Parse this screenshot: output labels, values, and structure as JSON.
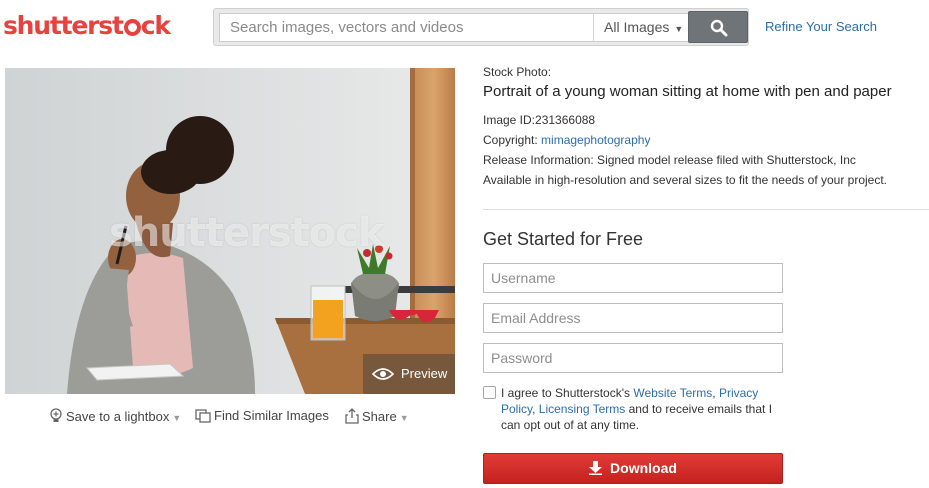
{
  "header": {
    "logo_pre": "shutterst",
    "logo_post": "ck",
    "search_placeholder": "Search images, vectors and videos",
    "filter_label": "All Images",
    "refine_link": "Refine Your Search"
  },
  "image": {
    "watermark": "shutterstock",
    "preview_label": "Preview"
  },
  "image_actions": {
    "lightbox": "Save to a lightbox",
    "similar": "Find Similar Images",
    "share": "Share"
  },
  "info": {
    "kicker": "Stock Photo:",
    "title": "Portrait of a young woman sitting at home with pen and paper",
    "image_id_label": "Image ID:",
    "image_id": "231366088",
    "copyright_label": "Copyright:",
    "copyright_value": "mimagephotography",
    "release": "Release Information: Signed model release filed with Shutterstock, Inc",
    "availability": "Available in high-resolution and several sizes to fit the needs of your project."
  },
  "signup": {
    "title": "Get Started for Free",
    "username_placeholder": "Username",
    "email_placeholder": "Email Address",
    "password_placeholder": "Password",
    "agree_pre": "I agree to Shutterstock's ",
    "website_terms": "Website Terms",
    "comma": ", ",
    "privacy_policy": "Privacy Policy",
    "licensing_terms": "Licensing Terms",
    "agree_post": " and to receive emails that I can opt out of at any time.",
    "download_label": "Download"
  },
  "colors": {
    "brand_red": "#e8423f",
    "link_blue": "#2b6eab",
    "download_red": "#d12c29"
  }
}
